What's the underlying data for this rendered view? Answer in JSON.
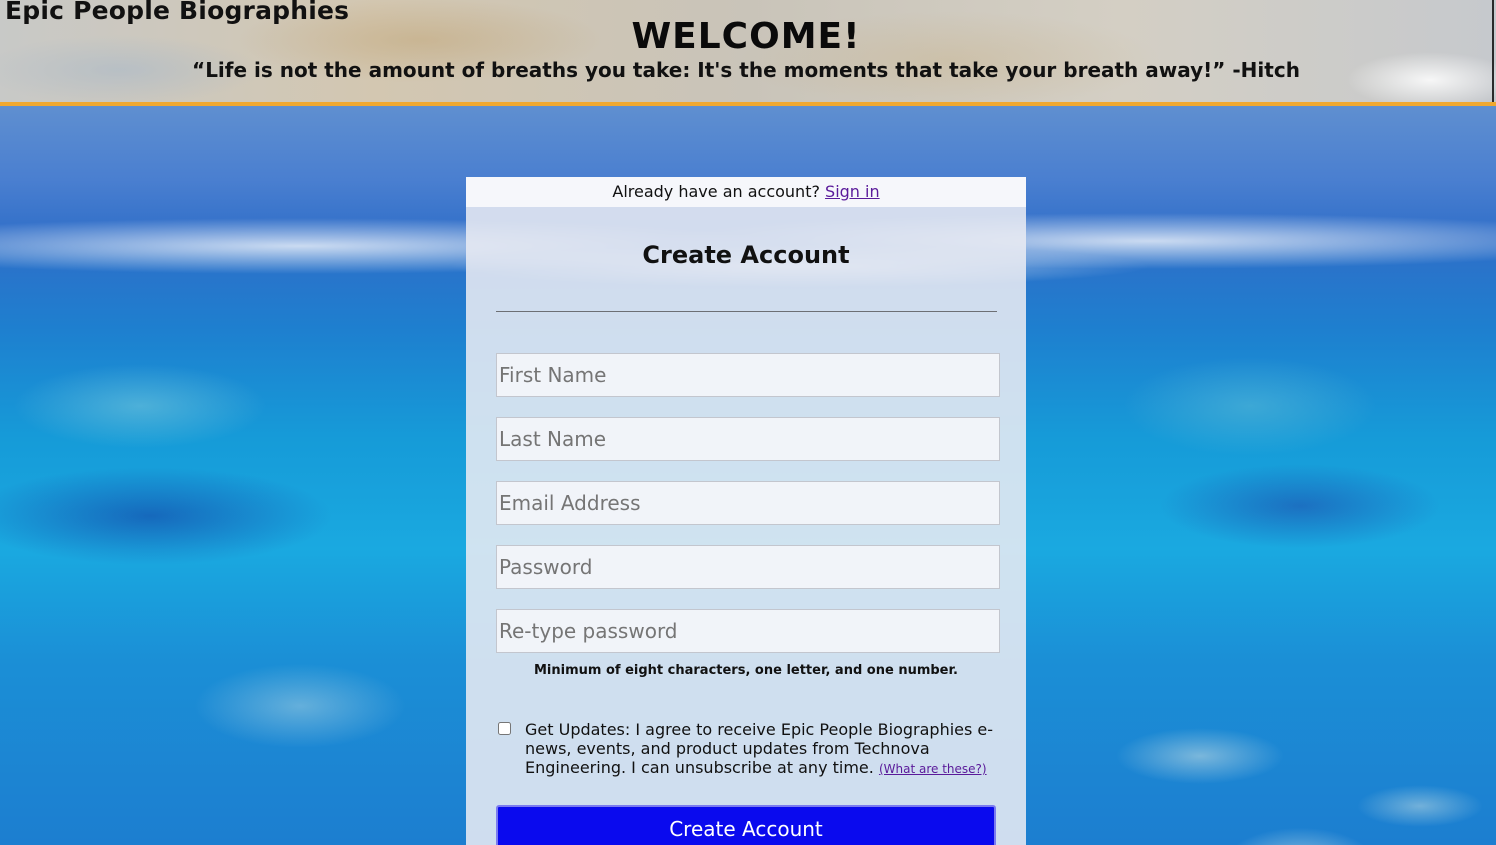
{
  "header": {
    "site_title": "Epic People Biographies",
    "welcome": "WELCOME!",
    "quote": "“Life is not the amount of breaths you take: It's the moments that take your breath away!” -Hitch",
    "accent_color": "#f0a830"
  },
  "signin": {
    "prompt": "Already have an account? ",
    "link_label": "Sign in"
  },
  "form": {
    "title": "Create Account",
    "fields": [
      {
        "placeholder": "First Name",
        "value": ""
      },
      {
        "placeholder": "Last Name",
        "value": ""
      },
      {
        "placeholder": "Email Address",
        "value": ""
      },
      {
        "placeholder": "Password",
        "value": ""
      },
      {
        "placeholder": "Re-type password",
        "value": ""
      }
    ],
    "password_hint": "Minimum of eight characters, one letter, and one number.",
    "updates": {
      "checked": false,
      "text": "Get Updates: I agree to receive Epic People Biographies e-news, events, and product updates from Technova Engineering. I can unsubscribe at any time. ",
      "link_label": "(What are these?)"
    },
    "submit_label": "Create Account",
    "submit_color": "#0a0aee"
  }
}
